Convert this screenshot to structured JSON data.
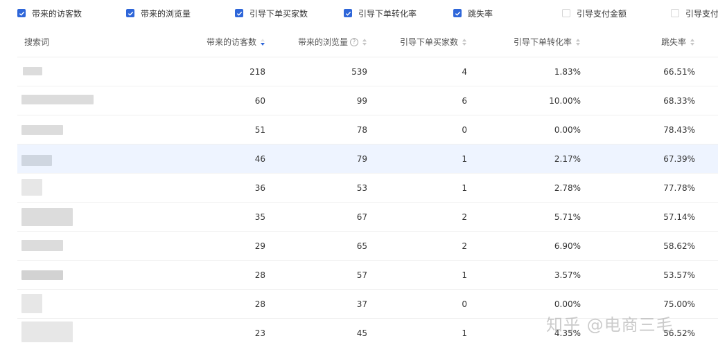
{
  "filters": [
    {
      "label": "带来的访客数",
      "checked": true
    },
    {
      "label": "带来的浏览量",
      "checked": true
    },
    {
      "label": "引导下单买家数",
      "checked": true
    },
    {
      "label": "引导下单转化率",
      "checked": true
    },
    {
      "label": "跳失率",
      "checked": true
    },
    {
      "label": "引导支付金额",
      "checked": false
    },
    {
      "label": "引导支付",
      "checked": false
    }
  ],
  "table": {
    "headers": {
      "keyword": "搜索词",
      "visitors": "带来的访客数",
      "pageviews": "带来的浏览量",
      "buyers": "引导下单买家数",
      "conversion": "引导下单转化率",
      "bounce": "跳失率"
    },
    "help_icon": "?",
    "sorted_column": "visitors",
    "sort_direction": "desc",
    "rows": [
      {
        "visitors": "218",
        "pageviews": "539",
        "buyers": "4",
        "conversion": "1.83%",
        "bounce": "66.51%"
      },
      {
        "visitors": "60",
        "pageviews": "99",
        "buyers": "6",
        "conversion": "10.00%",
        "bounce": "68.33%"
      },
      {
        "visitors": "51",
        "pageviews": "78",
        "buyers": "0",
        "conversion": "0.00%",
        "bounce": "78.43%"
      },
      {
        "visitors": "46",
        "pageviews": "79",
        "buyers": "1",
        "conversion": "2.17%",
        "bounce": "67.39%"
      },
      {
        "visitors": "36",
        "pageviews": "53",
        "buyers": "1",
        "conversion": "2.78%",
        "bounce": "77.78%"
      },
      {
        "visitors": "35",
        "pageviews": "67",
        "buyers": "2",
        "conversion": "5.71%",
        "bounce": "57.14%"
      },
      {
        "visitors": "29",
        "pageviews": "65",
        "buyers": "2",
        "conversion": "6.90%",
        "bounce": "58.62%"
      },
      {
        "visitors": "28",
        "pageviews": "57",
        "buyers": "1",
        "conversion": "3.57%",
        "bounce": "53.57%"
      },
      {
        "visitors": "28",
        "pageviews": "37",
        "buyers": "0",
        "conversion": "0.00%",
        "bounce": "75.00%"
      },
      {
        "visitors": "23",
        "pageviews": "45",
        "buyers": "1",
        "conversion": "4.35%",
        "bounce": "56.52%"
      }
    ],
    "highlighted_row": 3
  },
  "watermark": "知乎 @电商三毛",
  "colors": {
    "accent": "#2e66d9",
    "row_highlight": "#eef4ff",
    "watermark": "#a0a0a0"
  }
}
